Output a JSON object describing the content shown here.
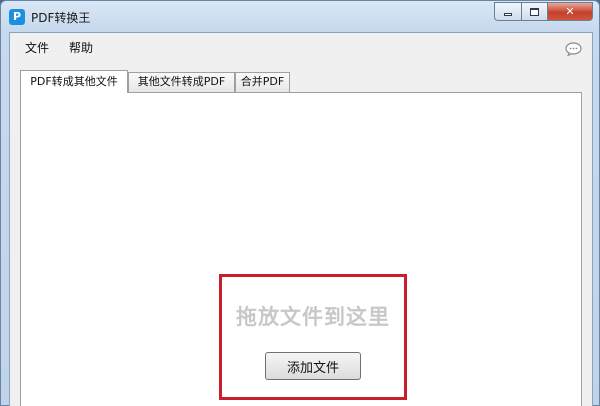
{
  "window": {
    "title": "PDF转换王",
    "icon": "pdf-app-icon",
    "icon_glyph": "P",
    "controls": {
      "minimize": "minimize",
      "maximize": "maximize",
      "close": "x"
    }
  },
  "menu": {
    "items": [
      {
        "label": "文件"
      },
      {
        "label": "帮助"
      }
    ],
    "feedback_icon": "chat-bubble-icon"
  },
  "tabs": [
    {
      "label": "PDF转成其他文件",
      "active": true
    },
    {
      "label": "其他文件转成PDF",
      "active": false
    },
    {
      "label": "合并PDF",
      "active": false
    }
  ],
  "dropzone": {
    "hint": "拖放文件到这里",
    "add_button": "添加文件",
    "highlight_color": "#c8202a"
  },
  "colors": {
    "close_button": "#c7402b",
    "app_icon": "#1d8fe1"
  }
}
